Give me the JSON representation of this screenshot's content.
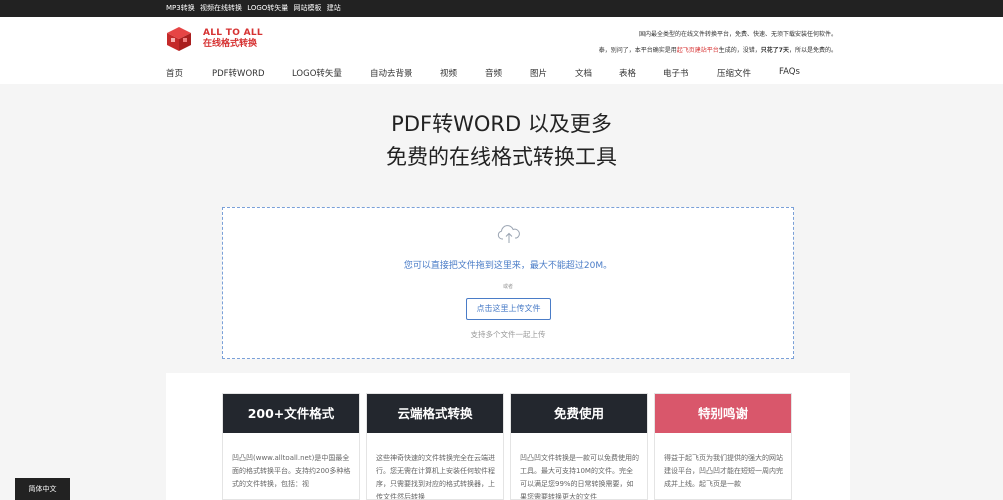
{
  "topbar": {
    "links": [
      "MP3转换",
      "视频在线转换",
      "LOGO转矢量",
      "网站模板",
      "建站"
    ]
  },
  "logo": {
    "line1": "ALL TO ALL",
    "line2": "在线格式转换"
  },
  "slogan": {
    "line1": "国内最全类型的在线文件转换平台，免费、快速、无须下载安装任何软件。",
    "line2_pre": "泰，别问了，本平台确实是用",
    "line2_red": "起飞页建站平台",
    "line2_mid": "生成的，没错，",
    "line2_bold": "只花了7天",
    "line2_post": "，所以是免费的。"
  },
  "nav": [
    "首页",
    "PDF转WORD",
    "LOGO转矢量",
    "自动去背景",
    "视频",
    "音频",
    "图片",
    "文档",
    "表格",
    "电子书",
    "压缩文件",
    "FAQs"
  ],
  "hero": {
    "title1": "PDF转WORD 以及更多",
    "title2": "免费的在线格式转换工具"
  },
  "upload": {
    "drop_text": "您可以直接把文件拖到这里来，最大不能超过20M。",
    "or": "或者",
    "button": "点击这里上传文件",
    "multi": "支持多个文件一起上传"
  },
  "cards": [
    {
      "title": "200+文件格式",
      "text": "凹凸凹(www.alltoall.net)是中国最全面的格式转换平台。支持约200多种格式的文件转换，包括：视"
    },
    {
      "title": "云端格式转换",
      "text": "这些神奇快速的文件转换完全在云端进行。您无需在计算机上安装任何软件程序，只需要找到对应的格式转换器，上传文件然后转换"
    },
    {
      "title": "免费使用",
      "text": "凹凸凹文件转换是一款可以免费使用的工具。最大可支持10M的文件。完全可以满足您99%的日常转换需要，如果您需要转换更大的文件"
    },
    {
      "title": "特别鸣谢",
      "text": "得益于起飞页为我们提供的强大的网站建设平台，凹凸凹才能在短短一周内完成并上线。起飞页是一款"
    }
  ],
  "lang": "简体中文",
  "colors": {
    "brand_red": "#d63232",
    "link_blue": "#4a7cc7",
    "dark": "#23272e",
    "pink": "#d9576b"
  }
}
